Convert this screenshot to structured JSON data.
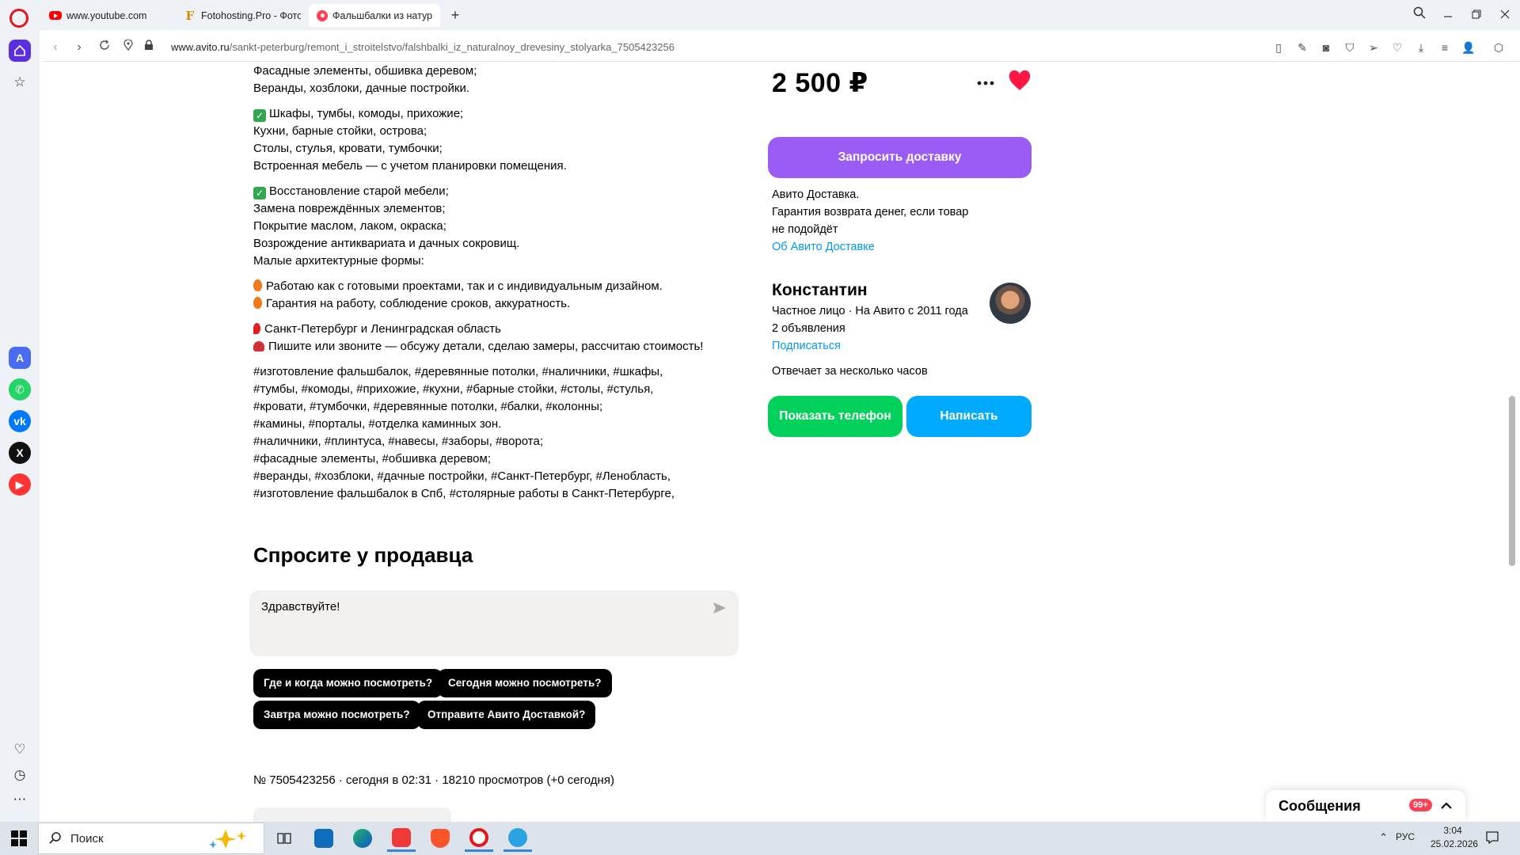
{
  "browser": {
    "tabs": [
      {
        "title": "www.youtube.com",
        "favicon": "youtube-icon",
        "active": false
      },
      {
        "title": "Fotohosting.Pro - Фотохостинг",
        "favicon": "fotohosting-icon",
        "active": false
      },
      {
        "title": "Фальшбалки из натуральной древесины",
        "favicon": "avito-icon",
        "active": true
      }
    ],
    "url_domain": "www.avito.ru",
    "url_path": "/sankt-peterburg/remont_i_stroitelstvo/falshbalki_iz_naturalnoy_drevesiny_stolyarka_7505423256"
  },
  "description": {
    "lines_a": [
      "Фасадные элементы, обшивка деревом;",
      "Веранды, хозблоки, дачные постройки."
    ],
    "lines_b": [
      "Шкафы, тумбы, комоды, прихожие;",
      "Кухни, барные стойки, острова;",
      "Столы, стулья, кровати, тумбочки;",
      "Встроенная мебель — с учетом планировки помещения."
    ],
    "lines_c": [
      "Восстановление старой мебели;",
      "Замена повреждённых элементов;",
      "Покрытие маслом, лаком, окраска;",
      "Возрождение антиквариата и дачных сокровищ.",
      "Малые архитектурные формы:"
    ],
    "lines_d": [
      "Работаю как с готовыми проектами, так и с индивидуальным дизайном.",
      "Гарантия на работу, соблюдение сроков, аккуратность."
    ],
    "lines_e": [
      "Санкт-Петербург и Ленинградская область",
      "Пишите или звоните — обсужу детали, сделаю замеры, рассчитаю стоимость!"
    ],
    "hashtags": [
      "#изготовление фальшбалок, #деревянные потолки, #наличники, #шкафы,",
      "#тумбы, #комоды, #прихожие, #кухни, #барные стойки, #столы, #стулья,",
      "#кровати, #тумбочки, #деревянные потолки, #балки, #колонны;",
      "#камины, #порталы, #отделка каминных зон.",
      "#наличники, #плинтуса, #навесы, #заборы, #ворота;",
      "#фасадные элементы, #обшивка деревом;",
      "#веранды, #хозблоки, #дачные постройки, #Санкт-Петербург, #Ленобласть,",
      "#изготовление фальшбалок в Спб, #столярные работы в Санкт-Петербурге,"
    ]
  },
  "ask": {
    "title": "Спросите у продавца",
    "input_value": "Здравствуйте!",
    "chips": [
      "Где и когда можно посмотреть?",
      "Сегодня можно посмотреть?",
      "Завтра можно посмотреть?",
      "Отправите Авито Доставкой?"
    ]
  },
  "meta": "№ 7505423256 · сегодня в 02:31 · 18210 просмотров (+0 сегодня)",
  "offer": {
    "price": "2 500 ₽",
    "delivery_button": "Запросить доставку",
    "delivery_lines": [
      "Авито Доставка.",
      "Гарантия возврата денег, если товар",
      "не подойдёт"
    ],
    "delivery_link": "Об Авито Доставке"
  },
  "seller": {
    "name": "Константин",
    "type_line": "Частное лицо · На Авито с 2011 года",
    "ads_count": "2 объявления",
    "subscribe": "Подписаться",
    "response": "Отвечает за несколько часов",
    "phone_button": "Показать телефон",
    "write_button": "Написать"
  },
  "messages": {
    "label": "Сообщения",
    "badge": "99+"
  },
  "taskbar": {
    "search_placeholder": "Поиск",
    "lang": "РУС",
    "time": "3:04",
    "date": "25.02.2026"
  },
  "colors": {
    "accent_purple": "#9b5cf6",
    "green": "#02d15c",
    "blue": "#00aaff",
    "link": "#0099f7",
    "favorite": "#ff1744"
  }
}
